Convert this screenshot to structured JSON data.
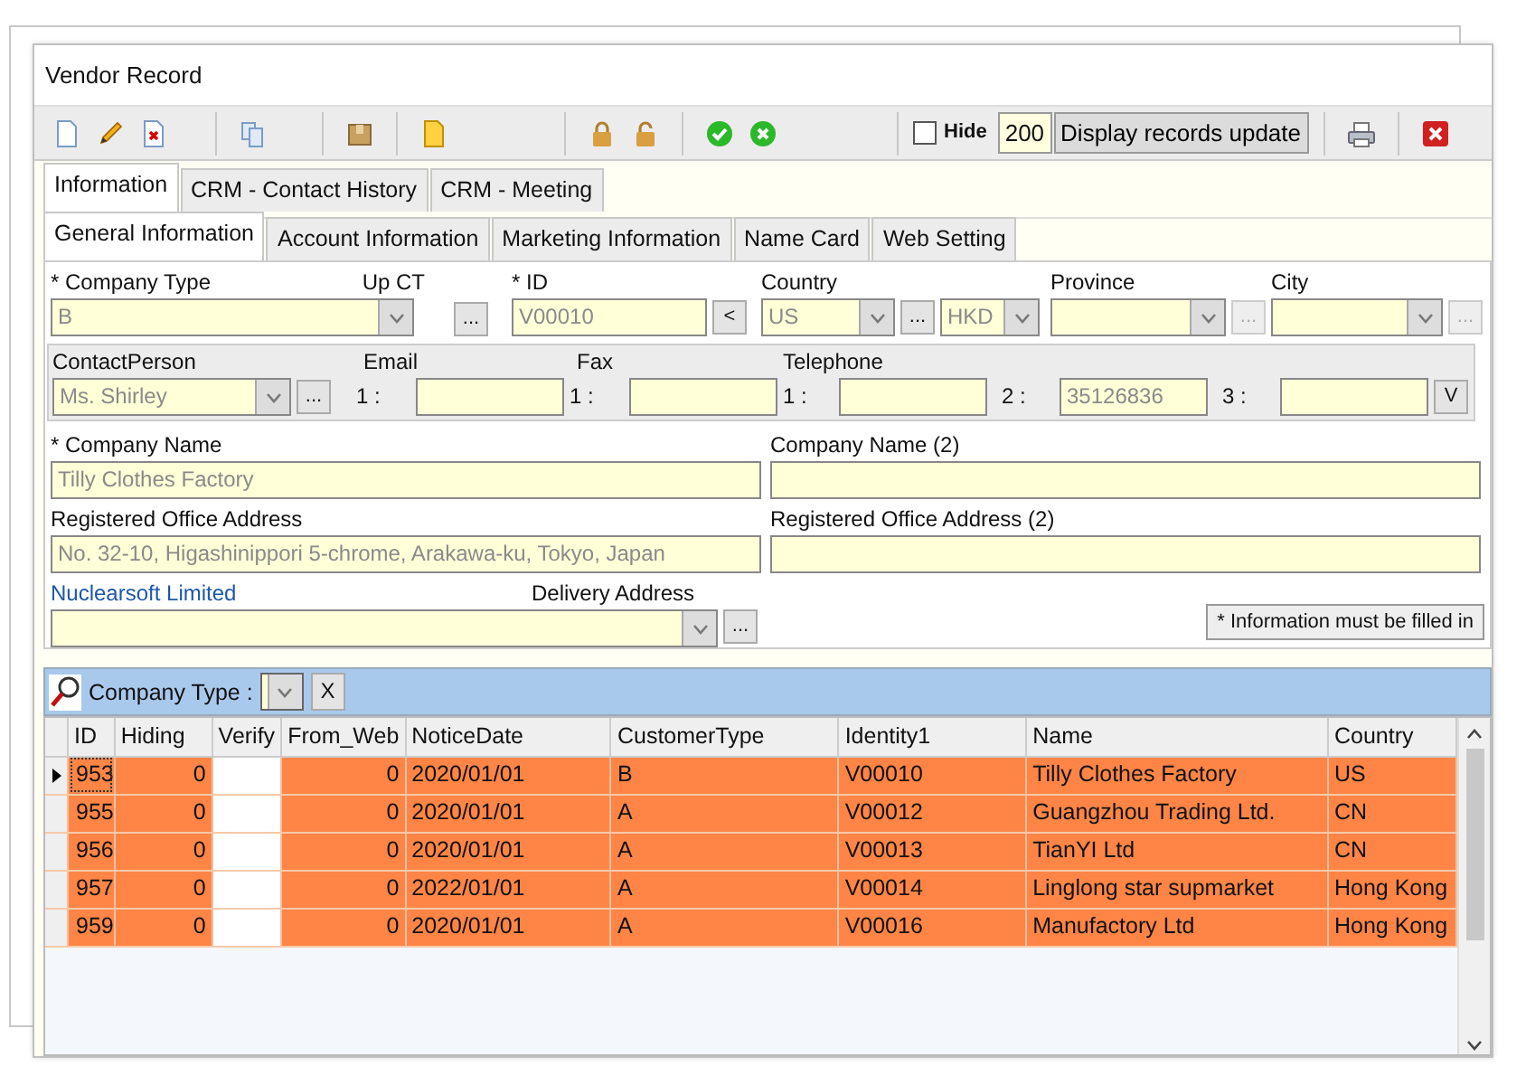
{
  "window": {
    "title": "Vendor Record"
  },
  "toolbar": {
    "hide": {
      "label": "Hide",
      "checked": false
    },
    "record_count": "200",
    "update_button": "Display records update"
  },
  "tabs": [
    {
      "label": "Information",
      "selected": true
    },
    {
      "label": "CRM - Contact History",
      "selected": false
    },
    {
      "label": "CRM - Meeting",
      "selected": false
    }
  ],
  "subtabs": [
    {
      "label": "General Information",
      "selected": true
    },
    {
      "label": "Account Information",
      "selected": false
    },
    {
      "label": "Marketing Information",
      "selected": false
    },
    {
      "label": "Name Card",
      "selected": false
    },
    {
      "label": "Web Setting",
      "selected": false
    }
  ],
  "form": {
    "company_type": {
      "label": "* Company Type",
      "up_label": "Up CT",
      "value": "B",
      "more_button": "..."
    },
    "id": {
      "label": "* ID",
      "value": "V00010",
      "back_button": "<"
    },
    "country": {
      "label": "Country",
      "value": "US",
      "more_button": "...",
      "more_disabled": false,
      "currency": "HKD"
    },
    "province": {
      "label": "Province",
      "more_button": "...",
      "more_disabled": true
    },
    "city": {
      "label": "City",
      "more_button": "...",
      "more_disabled": true
    },
    "contact_person": {
      "label": "ContactPerson",
      "value": "Ms. Shirley",
      "more_button": "..."
    },
    "email": {
      "label": "Email",
      "index": "1 :"
    },
    "fax": {
      "label": "Fax",
      "index": "1 :"
    },
    "telephone": {
      "label": "Telephone",
      "lines": [
        {
          "index": "1 :"
        },
        {
          "index": "2 :",
          "value": "35126836"
        },
        {
          "index": "3 :"
        }
      ],
      "dropdown_button": "V"
    },
    "company_name": {
      "label": "* Company Name",
      "value": "Tilly Clothes Factory"
    },
    "company_name_2": {
      "label": "Company Name (2)"
    },
    "office_address": {
      "label": "Registered Office Address",
      "value": "No. 32-10, Higashinippori 5-chrome, Arakawa-ku, Tokyo, Japan"
    },
    "office_address_2": {
      "label": "Registered Office Address (2)"
    },
    "company_link": "Nuclearsoft Limited",
    "delivery_address": {
      "label": "Delivery Address",
      "more_button": "..."
    },
    "required_note": "* Information must be filled in"
  },
  "filter": {
    "label": "Company Type :",
    "clear_button": "X"
  },
  "grid": {
    "columns": [
      "ID",
      "Hiding",
      "Verify",
      "From_Web",
      "NoticeDate",
      "CustomerType",
      "Identity1",
      "Name",
      "Country"
    ],
    "rows": [
      {
        "selected": true,
        "cells": [
          "953",
          "0",
          null,
          "0",
          "2020/01/01",
          "B",
          "V00010",
          "Tilly Clothes Factory",
          "US"
        ]
      },
      {
        "selected": false,
        "cells": [
          "955",
          "0",
          null,
          "0",
          "2020/01/01",
          "A",
          "V00012",
          "Guangzhou Trading Ltd.",
          "CN"
        ]
      },
      {
        "selected": false,
        "cells": [
          "956",
          "0",
          null,
          "0",
          "2020/01/01",
          "A",
          "V00013",
          "TianYI  Ltd",
          "CN"
        ]
      },
      {
        "selected": false,
        "cells": [
          "957",
          "0",
          null,
          "0",
          "2022/01/01",
          "A",
          "V00014",
          "Linglong star  supmarket",
          "Hong Kong"
        ]
      },
      {
        "selected": false,
        "cells": [
          "959",
          "0",
          null,
          "0",
          "2020/01/01",
          "A",
          "V00016",
          "Manufactory Ltd",
          "Hong Kong"
        ]
      }
    ]
  }
}
